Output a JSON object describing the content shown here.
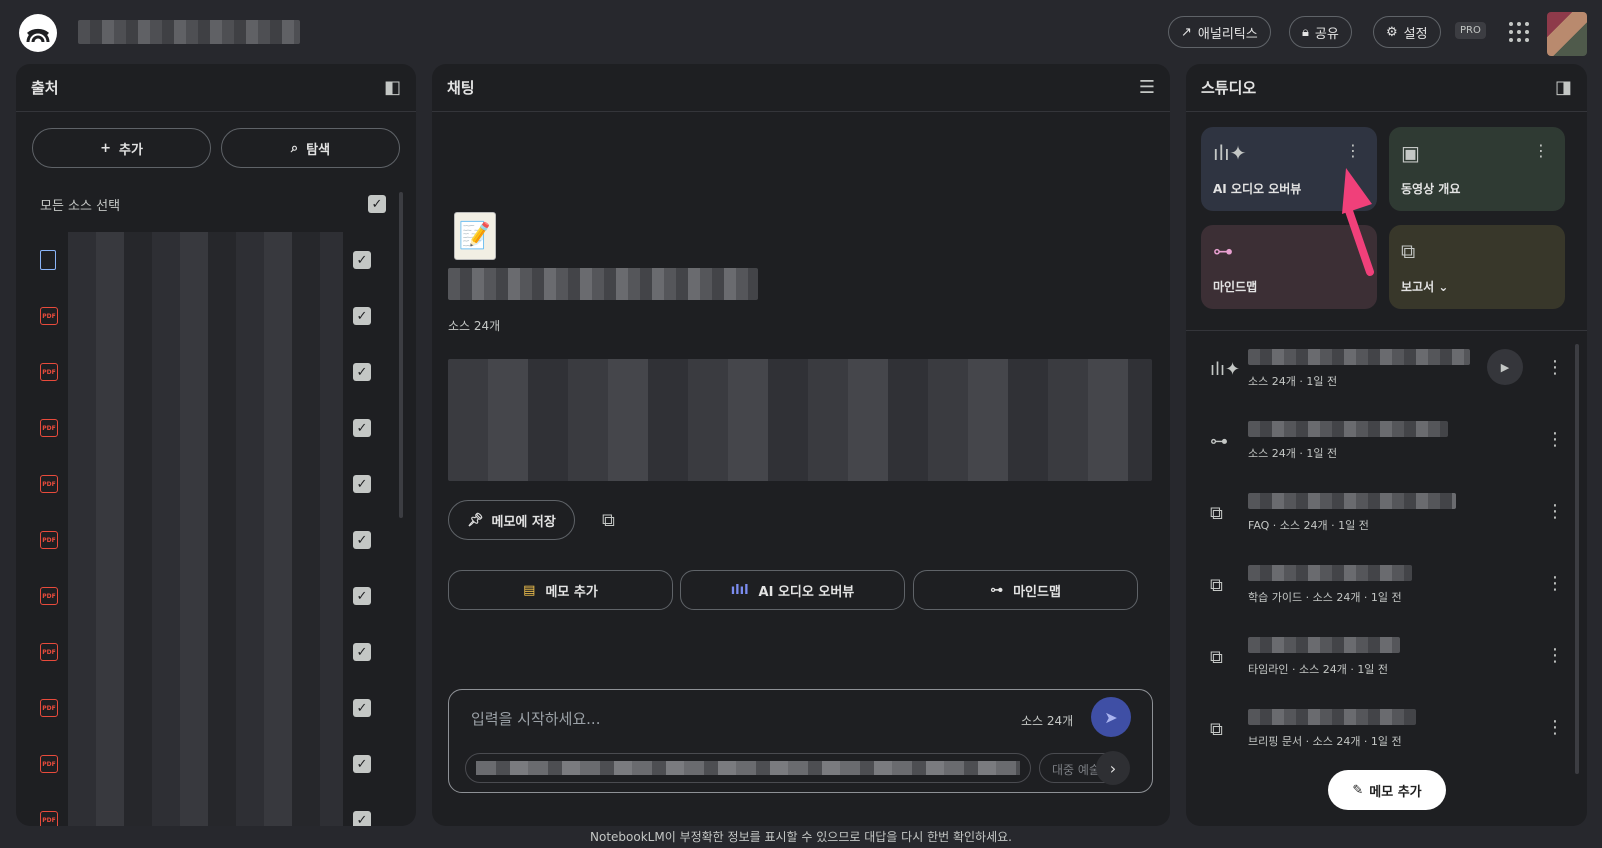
{
  "header": {
    "analytics_label": "애널리틱스",
    "share_label": "공유",
    "settings_label": "설정",
    "pro_badge": "PRO"
  },
  "sources": {
    "title": "출처",
    "add_label": "추가",
    "explore_label": "탐색",
    "select_all_label": "모든 소스 선택",
    "items": [
      {
        "type": "doc"
      },
      {
        "type": "pdf"
      },
      {
        "type": "pdf"
      },
      {
        "type": "pdf"
      },
      {
        "type": "pdf"
      },
      {
        "type": "pdf"
      },
      {
        "type": "pdf"
      },
      {
        "type": "pdf"
      },
      {
        "type": "pdf"
      },
      {
        "type": "pdf"
      },
      {
        "type": "pdf"
      }
    ],
    "pdf_icon_text": "PDF"
  },
  "chat": {
    "title": "채팅",
    "source_count": "소스 24개",
    "save_note_label": "메모에 저장",
    "suggestions": [
      "메모 추가",
      "AI 오디오 오버뷰",
      "마인드맵"
    ],
    "input_placeholder": "입력을 시작하세요...",
    "input_source_count": "소스 24개",
    "chip_partial": "대중 예술"
  },
  "studio": {
    "title": "스튜디오",
    "tiles": [
      {
        "label": "AI 오디오 오버뷰",
        "color": "#2f3441",
        "icon": "audio-wave-icon"
      },
      {
        "label": "동영상 개요",
        "color": "#2f3a33",
        "icon": "video-icon"
      },
      {
        "label": "마인드맵",
        "color": "#3c2f35",
        "icon": "mindmap-icon"
      },
      {
        "label": "보고서",
        "color": "#38372a",
        "icon": "report-icon"
      }
    ],
    "items": [
      {
        "icon": "audio-wave-icon",
        "meta": "소스 24개 · 1일 전"
      },
      {
        "icon": "mindmap-icon",
        "meta": "소스 24개 · 1일 전"
      },
      {
        "icon": "report-icon",
        "meta": "FAQ · 소스 24개 · 1일 전"
      },
      {
        "icon": "report-icon",
        "meta": "학습 가이드 · 소스 24개 · 1일 전"
      },
      {
        "icon": "report-icon",
        "meta": "타임라인 · 소스 24개 · 1일 전"
      },
      {
        "icon": "report-icon",
        "meta": "브리핑 문서 · 소스 24개 · 1일 전"
      }
    ],
    "add_note_label": "메모 추가"
  },
  "footer": {
    "disclaimer": "NotebookLM이 부정확한 정보를 표시할 수 있으므로 대답을 다시 한번 확인하세요."
  },
  "colors": {
    "accent_pink": "#f0407a",
    "send_button": "#3f4fa5",
    "pdf_red": "#e84b3c"
  }
}
